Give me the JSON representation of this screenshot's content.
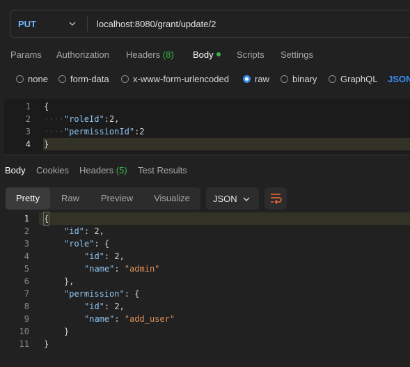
{
  "request": {
    "method": "PUT",
    "url": "localhost:8080/grant/update/2"
  },
  "request_tabs": [
    {
      "label": "Params"
    },
    {
      "label": "Authorization"
    },
    {
      "label": "Headers",
      "count": "(8)"
    },
    {
      "label": "Body"
    },
    {
      "label": "Scripts"
    },
    {
      "label": "Settings"
    }
  ],
  "body_types": [
    {
      "label": "none",
      "checked": false
    },
    {
      "label": "form-data",
      "checked": false
    },
    {
      "label": "x-www-form-urlencoded",
      "checked": false
    },
    {
      "label": "raw",
      "checked": true
    },
    {
      "label": "binary",
      "checked": false
    },
    {
      "label": "GraphQL",
      "checked": false
    }
  ],
  "raw_format": "JSON",
  "request_body": {
    "line_numbers": [
      "1",
      "2",
      "3",
      "4"
    ],
    "lines": [
      "{",
      "\"roleId\":2,",
      "\"permissionId\":2",
      "}"
    ]
  },
  "response_tabs": [
    {
      "label": "Body"
    },
    {
      "label": "Cookies"
    },
    {
      "label": "Headers",
      "count": "(5)"
    },
    {
      "label": "Test Results"
    }
  ],
  "view_modes": [
    "Pretty",
    "Raw",
    "Preview",
    "Visualize"
  ],
  "response_format": "JSON",
  "response_body": {
    "line_numbers": [
      "1",
      "2",
      "3",
      "4",
      "5",
      "6",
      "7",
      "8",
      "9",
      "10",
      "11"
    ],
    "lines": [
      "{",
      "\"id\": 2,",
      "\"role\": {",
      "\"id\": 2,",
      "\"name\": \"admin\"",
      "},",
      "\"permission\": {",
      "\"id\": 2,",
      "\"name\": \"add_user\"",
      "}",
      "}"
    ]
  },
  "colors": {
    "accent_orange": "#ff6c37",
    "status_green": "#39b34a",
    "link_blue": "#3d8cf5",
    "method_blue": "#6fb7ff"
  }
}
